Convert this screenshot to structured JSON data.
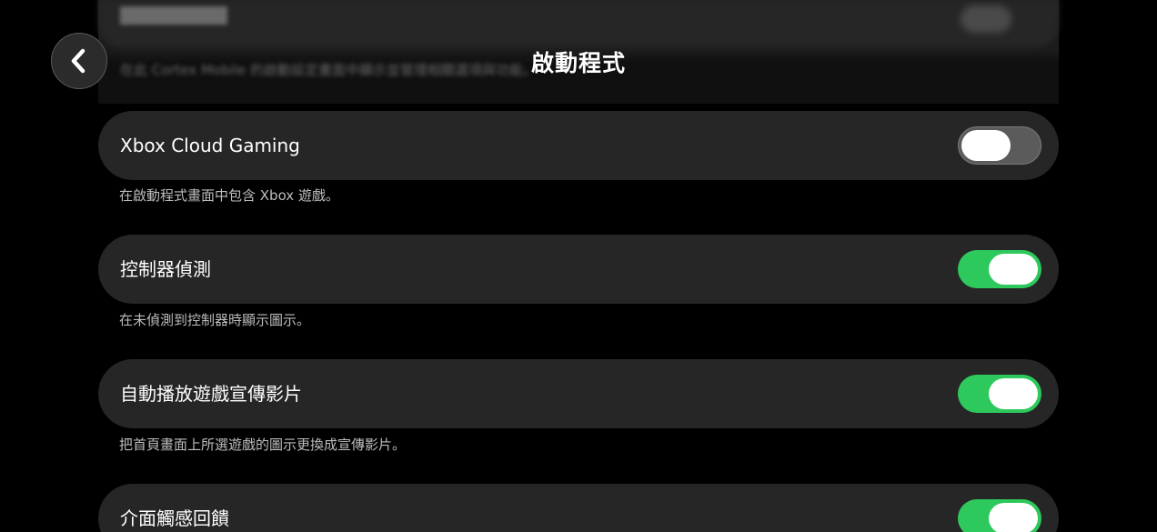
{
  "header": {
    "title": "啟動程式",
    "back_label": "back",
    "ghost_desc": "在此 Cortex Mobile 的啟動設定畫面中顯示並管理相關選項與功能。"
  },
  "settings": [
    {
      "label": "Xbox Cloud Gaming",
      "description": "在啟動程式畫面中包含 Xbox 遊戲。",
      "enabled": false
    },
    {
      "label": "控制器偵測",
      "description": "在未偵測到控制器時顯示圖示。",
      "enabled": true
    },
    {
      "label": "自動播放遊戲宣傳影片",
      "description": "把首頁畫面上所選遊戲的圖示更換成宣傳影片。",
      "enabled": true
    },
    {
      "label": "介面觸感回饋",
      "description": "",
      "enabled": true
    }
  ],
  "colors": {
    "toggle_on": "#2ec95c",
    "toggle_off": "#5b5b5b",
    "row_bg": "#262626",
    "background": "#000000"
  },
  "icons": {
    "back": "chevron-left-icon"
  }
}
